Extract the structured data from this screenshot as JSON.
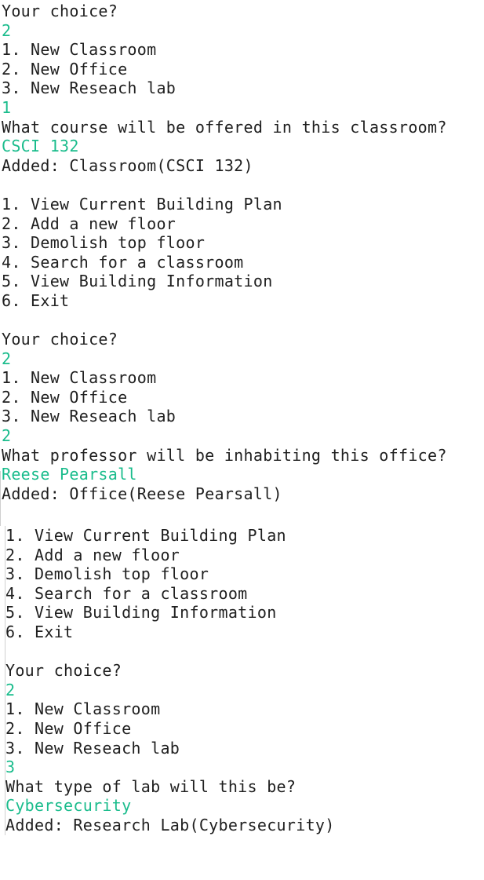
{
  "console": {
    "section1": [
      {
        "text": "Your choice?",
        "kind": "output"
      },
      {
        "text": "2",
        "kind": "input"
      },
      {
        "text": "1. New Classroom",
        "kind": "output"
      },
      {
        "text": "2. New Office",
        "kind": "output"
      },
      {
        "text": "3. New Reseach lab",
        "kind": "output"
      },
      {
        "text": "1",
        "kind": "input"
      },
      {
        "text": "What course will be offered in this classroom?",
        "kind": "output"
      },
      {
        "text": "CSCI 132",
        "kind": "input"
      },
      {
        "text": "Added: Classroom(CSCI 132)",
        "kind": "output"
      },
      {
        "text": "",
        "kind": "blank"
      },
      {
        "text": "1. View Current Building Plan",
        "kind": "output"
      },
      {
        "text": "2. Add a new floor",
        "kind": "output"
      },
      {
        "text": "3. Demolish top floor",
        "kind": "output"
      },
      {
        "text": "4. Search for a classroom",
        "kind": "output"
      },
      {
        "text": "5. View Building Information",
        "kind": "output"
      },
      {
        "text": "6. Exit",
        "kind": "output"
      },
      {
        "text": "",
        "kind": "blank"
      },
      {
        "text": "Your choice?",
        "kind": "output"
      },
      {
        "text": "2",
        "kind": "input"
      },
      {
        "text": "1. New Classroom",
        "kind": "output"
      },
      {
        "text": "2. New Office",
        "kind": "output"
      },
      {
        "text": "3. New Reseach lab",
        "kind": "output"
      },
      {
        "text": "2",
        "kind": "input"
      },
      {
        "text": "What professor will be inhabiting this office?",
        "kind": "output"
      },
      {
        "text": "Reese Pearsall",
        "kind": "input"
      },
      {
        "text": "Added: Office(Reese Pearsall)",
        "kind": "output"
      }
    ],
    "section2": [
      {
        "text": "1. View Current Building Plan",
        "kind": "output"
      },
      {
        "text": "2. Add a new floor",
        "kind": "output"
      },
      {
        "text": "3. Demolish top floor",
        "kind": "output"
      },
      {
        "text": "4. Search for a classroom",
        "kind": "output"
      },
      {
        "text": "5. View Building Information",
        "kind": "output"
      },
      {
        "text": "6. Exit",
        "kind": "output"
      },
      {
        "text": "",
        "kind": "blank"
      },
      {
        "text": "Your choice?",
        "kind": "output"
      },
      {
        "text": "2",
        "kind": "input"
      },
      {
        "text": "1. New Classroom",
        "kind": "output"
      },
      {
        "text": "2. New Office",
        "kind": "output"
      },
      {
        "text": "3. New Reseach lab",
        "kind": "output"
      },
      {
        "text": "3",
        "kind": "input"
      },
      {
        "text": "What type of lab will this be?",
        "kind": "output"
      },
      {
        "text": "Cybersecurity",
        "kind": "input"
      },
      {
        "text": "Added: Research Lab(Cybersecurity)",
        "kind": "output"
      }
    ],
    "colors": {
      "output_text": "#1f1f1f",
      "input_text": "#1abc8c",
      "background": "#ffffff"
    }
  }
}
